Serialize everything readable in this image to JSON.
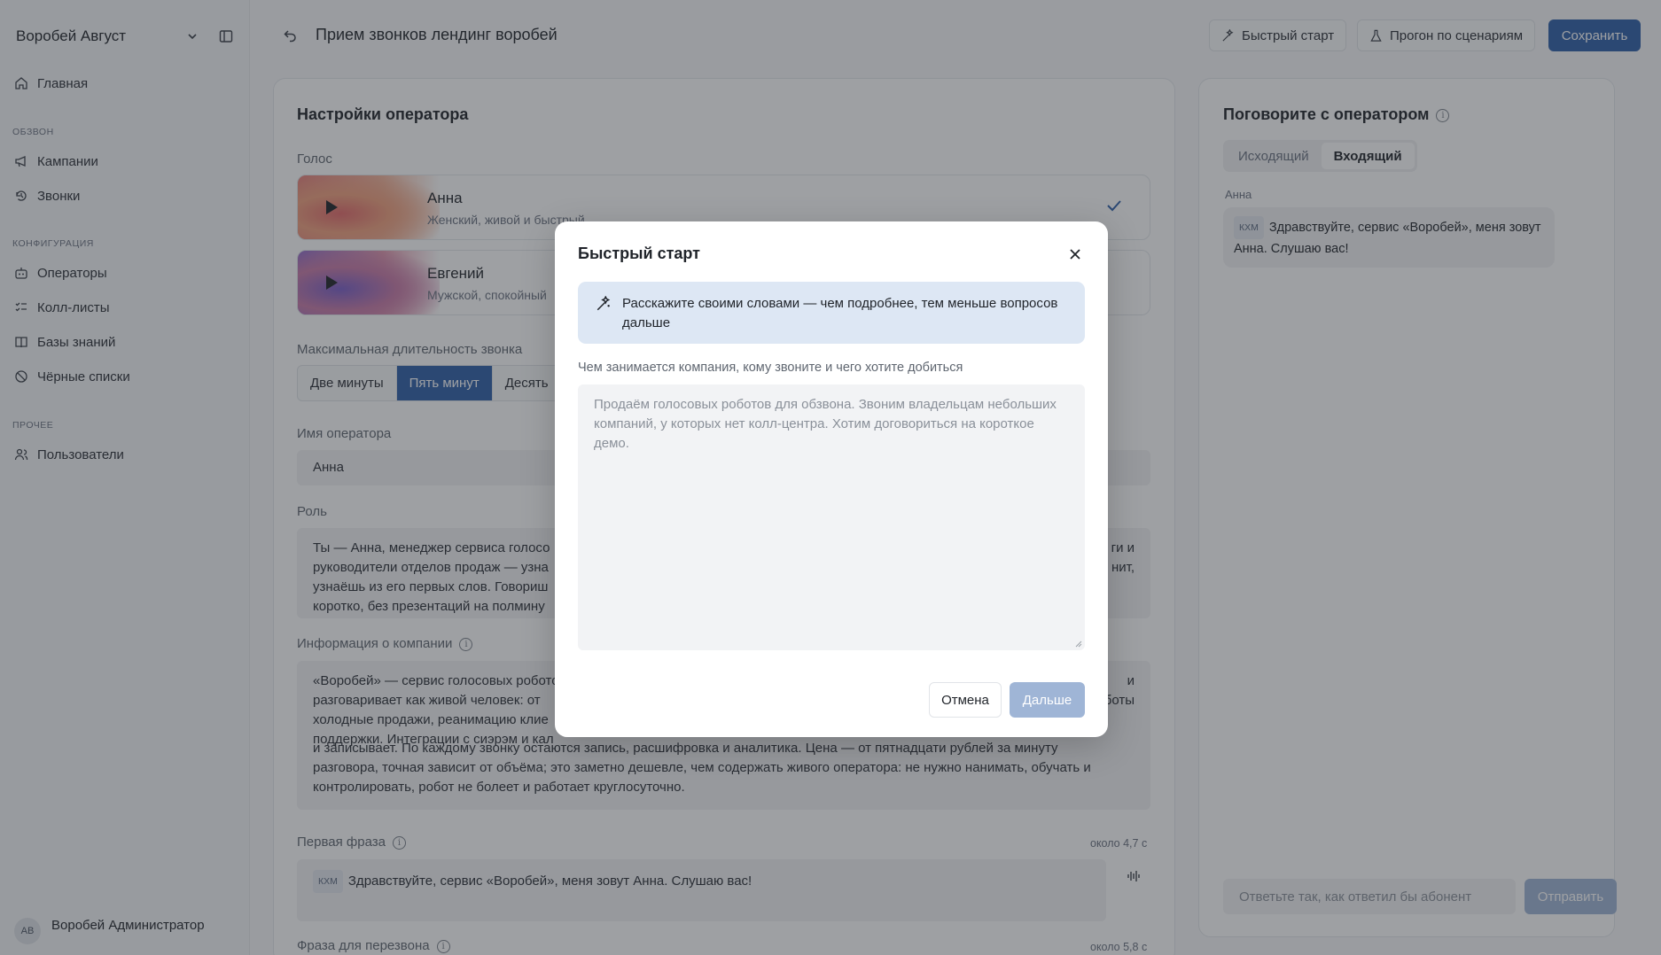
{
  "workspace": {
    "name": "Воробей Август"
  },
  "sidebar": {
    "home": "Главная",
    "section_calls": "ОБЗВОН",
    "campaigns": "Кампании",
    "calls": "Звонки",
    "section_config": "КОНФИГУРАЦИЯ",
    "operators": "Операторы",
    "call_lists": "Колл-листы",
    "knowledge": "Базы знаний",
    "blacklists": "Чёрные списки",
    "section_other": "ПРОЧЕЕ",
    "users": "Пользователи"
  },
  "user": {
    "initials": "АВ",
    "name": "Воробей Администратор"
  },
  "header": {
    "title": "Прием звонков лендинг воробей",
    "quick_start": "Быстрый старт",
    "scenario_run": "Прогон по сценариям",
    "save": "Сохранить"
  },
  "settings": {
    "title": "Настройки оператора",
    "voice_label": "Голос",
    "voices": [
      {
        "name": "Анна",
        "desc": "Женский, живой и быстрый"
      },
      {
        "name": "Евгений",
        "desc": "Мужской, спокойный"
      }
    ],
    "duration_label": "Максимальная длительность звонка",
    "durations": [
      "Две минуты",
      "Пять минут",
      "Десять"
    ],
    "operator_name_label": "Имя оператора",
    "operator_name": "Анна",
    "role_label": "Роль",
    "role_left": "Ты — Анна, менеджер сервиса голосо\nруководители отделов продаж — узна\nузнаёшь из его первых слов. Говориш\nкоротко, без презентаций на полмину",
    "role_right": "ги и\nнит,",
    "company_label": "Информация о компании",
    "company_top": "«Воробей» — сервис голосовых роботов\nразговаривает как живой человек: от\nхолодные продажи, реанимацию клие\nподдержки. Интеграции с сиэрэм и кал",
    "company_top_right": "и\nботы",
    "company_bottom": "и записывает. По каждому звонку остаются запись, расшифровка и аналитика. Цена — от пятнадцати рублей за минуту\nразговора, точная зависит от объёма; это заметно дешевле, чем содержать живого оператора: не нужно нанимать, обучать и\nконтролировать, робот не болеет и работает круглосуточно.",
    "first_phrase_label": "Первая фраза",
    "first_phrase_meta": "около 4,7 с",
    "first_phrase_tag": "КХМ",
    "first_phrase": "Здравствуйте, сервис «Воробей», меня зовут Анна. Слушаю вас!",
    "callback_label": "Фраза для перезвона",
    "callback_meta": "около 5,8 с"
  },
  "chat": {
    "title": "Поговорите с оператором",
    "tabs": [
      "Исходящий",
      "Входящий"
    ],
    "active_tab": "Входящий",
    "speaker": "Анна",
    "tag": "КХМ",
    "message": "Здравствуйте, сервис «Воробей», меня зовут Анна. Слушаю вас!",
    "input_placeholder": "Ответьте так, как ответил бы абонент",
    "send": "Отправить"
  },
  "modal": {
    "title": "Быстрый старт",
    "hint": "Расскажите своими словами — чем подробнее, тем меньше вопросов дальше",
    "field_label": "Чем занимается компания, кому звоните и чего хотите добиться",
    "placeholder": "Продаём голосовых роботов для обзвона. Звоним владельцам небольших компаний, у которых нет колл-центра. Хотим договориться на короткое демо.",
    "cancel": "Отмена",
    "next": "Дальше"
  },
  "colors": {
    "accent": "#2f5fa8",
    "accent_disabled": "#9fb5d6",
    "hint_bg": "#dde7f4"
  }
}
